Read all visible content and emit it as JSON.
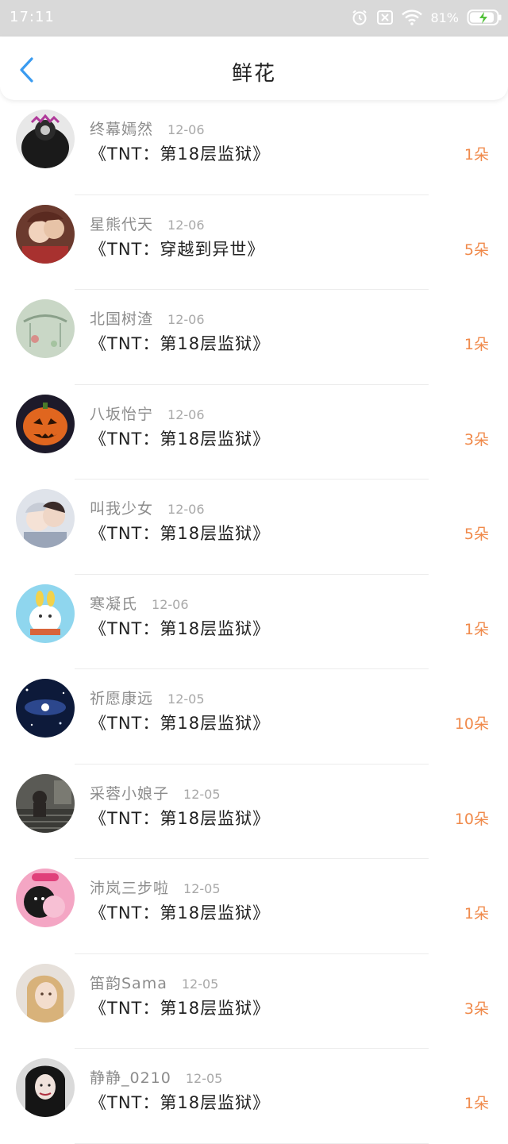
{
  "status_bar": {
    "time": "17:11",
    "battery": "81%",
    "icons": [
      "alarm-icon",
      "sim-icon",
      "wifi-icon",
      "battery-icon"
    ]
  },
  "header": {
    "title": "鲜花",
    "back_icon": "chevron-left-icon"
  },
  "colors": {
    "accent_back": "#3a9bf0",
    "count_orange": "#f08a4b",
    "status_bar_bg": "#d9d9d9"
  },
  "items": [
    {
      "user": "终幕嫣然",
      "date": "12-06",
      "book": "《TNT：第18层监狱》",
      "count": "1朵"
    },
    {
      "user": "星熊代天",
      "date": "12-06",
      "book": "《TNT：穿越到异世》",
      "count": "5朵"
    },
    {
      "user": "北国树渣",
      "date": "12-06",
      "book": "《TNT：第18层监狱》",
      "count": "1朵"
    },
    {
      "user": "八坂怡宁",
      "date": "12-06",
      "book": "《TNT：第18层监狱》",
      "count": "3朵"
    },
    {
      "user": "叫我少女",
      "date": "12-06",
      "book": "《TNT：第18层监狱》",
      "count": "5朵"
    },
    {
      "user": "寒凝氏",
      "date": "12-06",
      "book": "《TNT：第18层监狱》",
      "count": "1朵"
    },
    {
      "user": "祈愿康远",
      "date": "12-05",
      "book": "《TNT：第18层监狱》",
      "count": "10朵"
    },
    {
      "user": "采蓉小娘子",
      "date": "12-05",
      "book": "《TNT：第18层监狱》",
      "count": "10朵"
    },
    {
      "user": "沛岚三步啦",
      "date": "12-05",
      "book": "《TNT：第18层监狱》",
      "count": "1朵"
    },
    {
      "user": "笛韵Sama",
      "date": "12-05",
      "book": "《TNT：第18层监狱》",
      "count": "3朵"
    },
    {
      "user": "静静_0210",
      "date": "12-05",
      "book": "《TNT：第18层监狱》",
      "count": "1朵"
    }
  ]
}
